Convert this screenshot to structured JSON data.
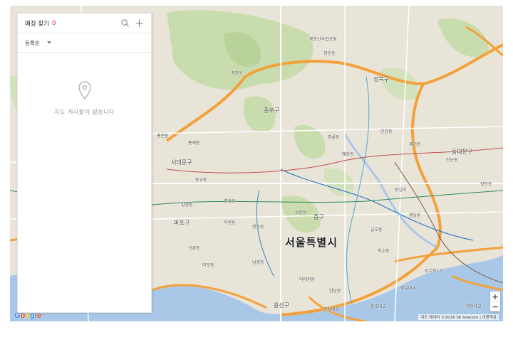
{
  "panel": {
    "title": "매장 찾기",
    "count": "0",
    "sort_label": "등록순",
    "empty_message": "지도 게시물이 없습니다",
    "icons": {
      "search": "search-icon",
      "add": "plus-icon",
      "sort": "chevron-down-icon",
      "empty": "map-pin-icon"
    }
  },
  "map": {
    "city_label": "서울특별시",
    "district_labels": [
      "종로구",
      "중구",
      "용산구",
      "서대문구",
      "성북구",
      "동대문구",
      "마포구"
    ],
    "neighborhood_labels": [
      "북한산국립공원",
      "청운동",
      "평창동",
      "홍은동",
      "홍제동",
      "신촌동",
      "충정로",
      "혜화동",
      "명륜동",
      "이태원동",
      "한남동",
      "성수동1가",
      "행당동",
      "전농동",
      "제기동",
      "안암동",
      "동교동",
      "합정동",
      "아현동",
      "마포동",
      "청파동",
      "회현동",
      "남영동",
      "옥수동",
      "금호동",
      "왕십리",
      "성수대교",
      "동호대교",
      "한남대교",
      "영동대교",
      "장안동"
    ],
    "logo": "Google",
    "attribution": "지도 데이터 ©2016 SK telecom | 이용약관",
    "zoom_in": "+",
    "zoom_out": "−",
    "colors": {
      "land": "#e9e4d8",
      "park": "#c9dcae",
      "water": "#a9c8e8",
      "highway": "#f3a13a",
      "road": "#ffffff"
    }
  }
}
